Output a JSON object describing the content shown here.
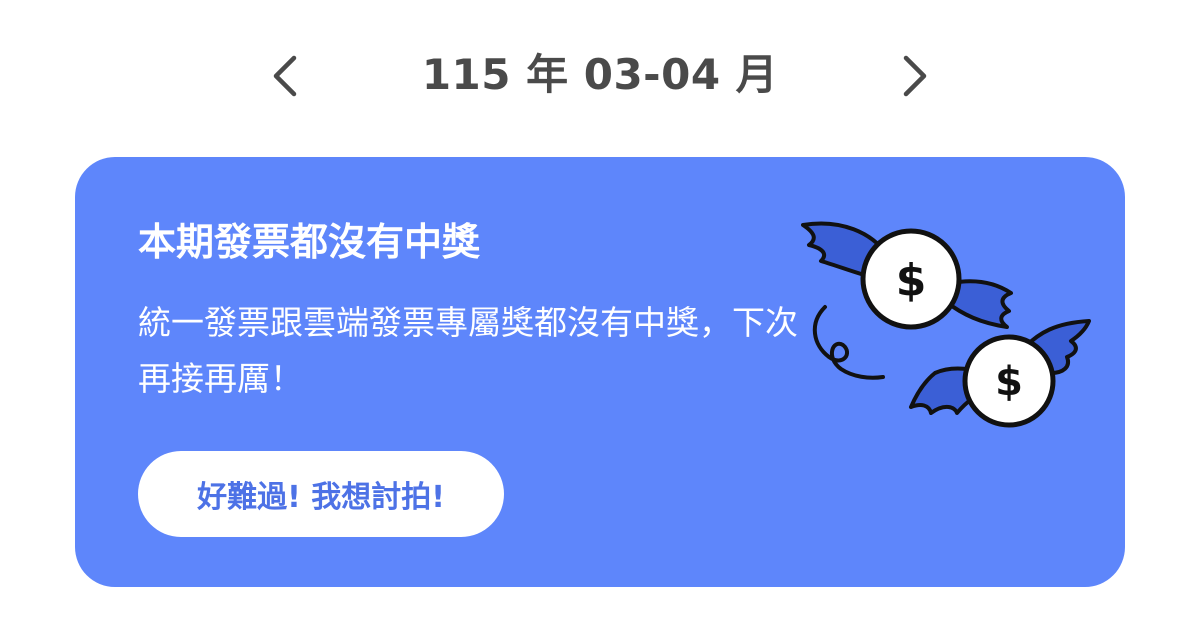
{
  "header": {
    "period_label": "115 年 03-04 月",
    "prev_icon": "chevron-left-icon",
    "next_icon": "chevron-right-icon"
  },
  "result_card": {
    "heading": "本期發票都沒有中獎",
    "message": "統一發票跟雲端發票專屬獎都沒有中獎，下次再接再厲！",
    "button_label": "好難過! 我想討拍!",
    "illustration_icon": "flying-money-icon",
    "background_color": "#5e86fb",
    "button_text_color": "#4d72e6"
  }
}
